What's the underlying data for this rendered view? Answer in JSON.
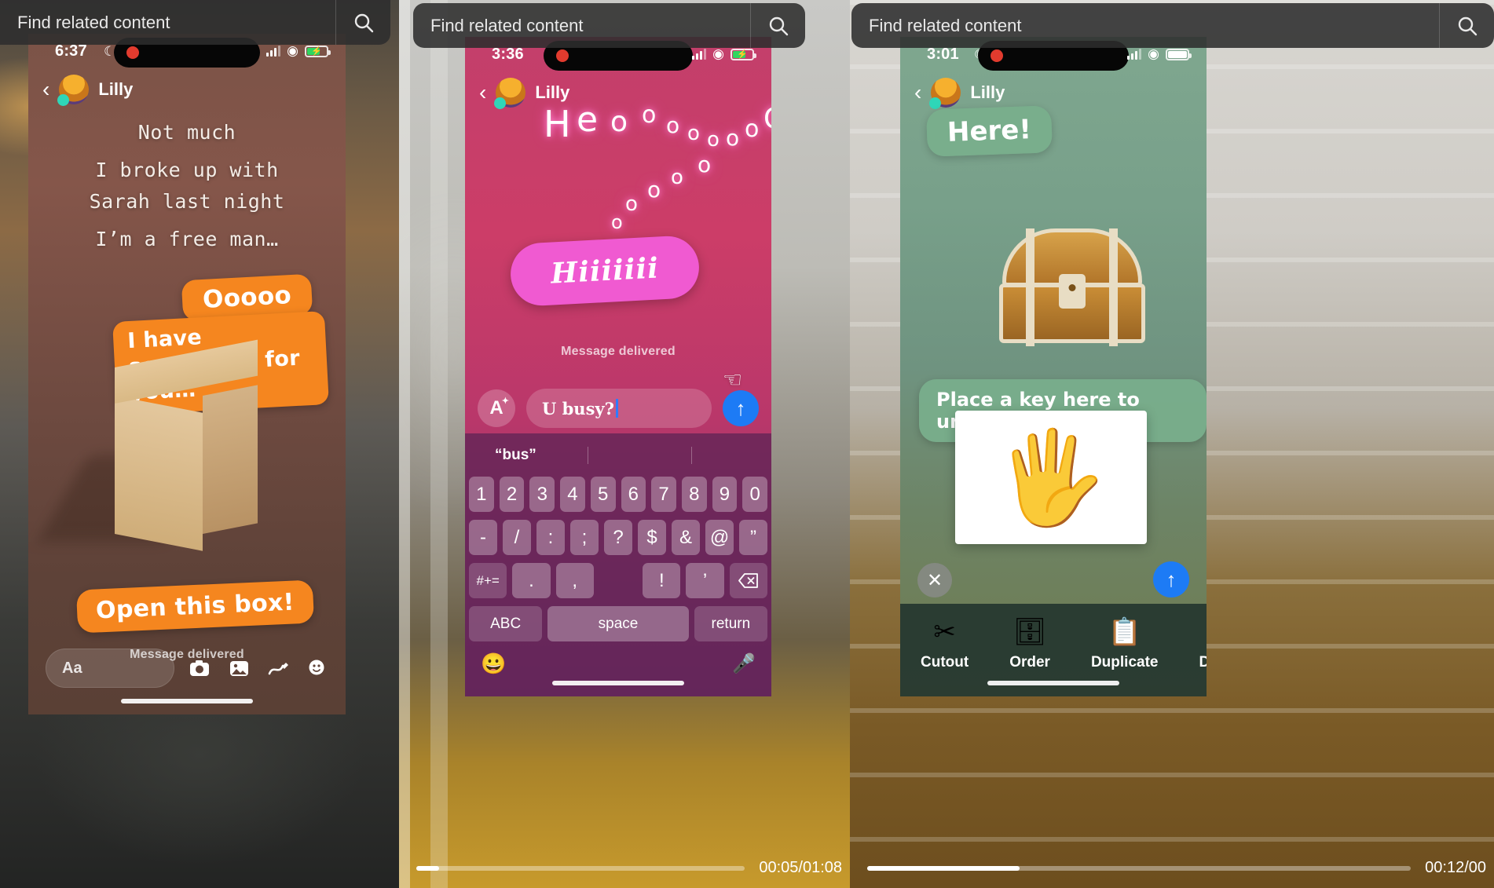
{
  "search_bars": [
    {
      "placeholder": "Find related content",
      "icon": "search-icon"
    },
    {
      "placeholder": "Find related content",
      "icon": "search-icon"
    },
    {
      "placeholder": "Find related content",
      "icon": "search-icon"
    }
  ],
  "panels": [
    {
      "id": "panel-1",
      "status_bar": {
        "time": "6:37",
        "moon_icon": "crescent-moon-icon",
        "signal": "cellular-signal-icon",
        "wifi": "wifi-icon",
        "battery": "battery-charging-icon"
      },
      "conversation": {
        "back_icon": "chevron-left-icon",
        "avatar": "contact-avatar",
        "name": "Lilly"
      },
      "message_lines": [
        "Not much",
        "I broke up with",
        "Sarah last night",
        "I’m a free man…"
      ],
      "stickers": [
        {
          "text": "Ooooo",
          "color": "#f5861f"
        },
        {
          "text": "I have something for you…",
          "color": "#f5861f"
        },
        {
          "text": "Open this box!",
          "color": "#f5861f"
        }
      ],
      "status_text": "Message delivered",
      "input": {
        "placeholder": "Aa",
        "value": ""
      },
      "tool_icons": [
        "camera-icon",
        "photos-icon",
        "markup-icon",
        "sticker-icon"
      ],
      "home_indicator": true
    },
    {
      "id": "panel-2",
      "status_bar": {
        "time": "3:36",
        "signal": "cellular-signal-icon",
        "wifi": "wifi-icon",
        "battery": "battery-charging-icon"
      },
      "conversation": {
        "back_icon": "chevron-left-icon",
        "avatar": "contact-avatar",
        "name": "Lilly"
      },
      "neon_text": "oooooooooo",
      "bubble_text": "Hiiiiiii",
      "status_text": "Message delivered",
      "input": {
        "value": "U busy?",
        "ai_button": "A",
        "send_icon": "send-arrow-up-icon"
      },
      "cursor_icon": "hand-cursor-icon",
      "keyboard": {
        "suggestion": "“bus”",
        "row1": [
          "1",
          "2",
          "3",
          "4",
          "5",
          "6",
          "7",
          "8",
          "9",
          "0"
        ],
        "row2": [
          "-",
          "/",
          ":",
          ";",
          "?",
          "$",
          "&",
          "@",
          "”"
        ],
        "row3": [
          "#+=",
          ".",
          ",",
          "!",
          "’",
          "delete-icon"
        ],
        "row4": [
          "ABC",
          "space",
          "return"
        ],
        "emoji_key": "emoji-icon",
        "dictation_key": "microphone-icon"
      }
    },
    {
      "id": "panel-3",
      "status_bar": {
        "time": "3:01",
        "moon_icon": "crescent-moon-icon",
        "signal": "cellular-signal-icon",
        "wifi": "wifi-icon",
        "battery": "battery-full-icon"
      },
      "conversation": {
        "back_icon": "chevron-left-icon",
        "avatar": "contact-avatar",
        "name": "Lilly"
      },
      "stickers": [
        {
          "text": "Here!",
          "color": "#78af8c"
        },
        {
          "text": "Place a key here to unlock",
          "color": "#78af8c"
        }
      ],
      "chest_icon": "treasure-chest-icon",
      "hand_image": "open-palm-hand-photo",
      "close_button": "close-icon",
      "send_button": "send-arrow-up-icon",
      "edit_toolbar": [
        {
          "label": "Cutout",
          "icon": "scissors-icon"
        },
        {
          "label": "Order",
          "icon": "layer-order-icon"
        },
        {
          "label": "Duplicate",
          "icon": "duplicate-x2-icon"
        },
        {
          "label": "Delete",
          "icon": "trash-icon"
        }
      ]
    }
  ],
  "progress_bars": [
    {
      "id": "progress-2",
      "percent": 7,
      "time": "00:05/01:08"
    },
    {
      "id": "progress-3",
      "percent": 28,
      "time": "00:12/00"
    }
  ]
}
